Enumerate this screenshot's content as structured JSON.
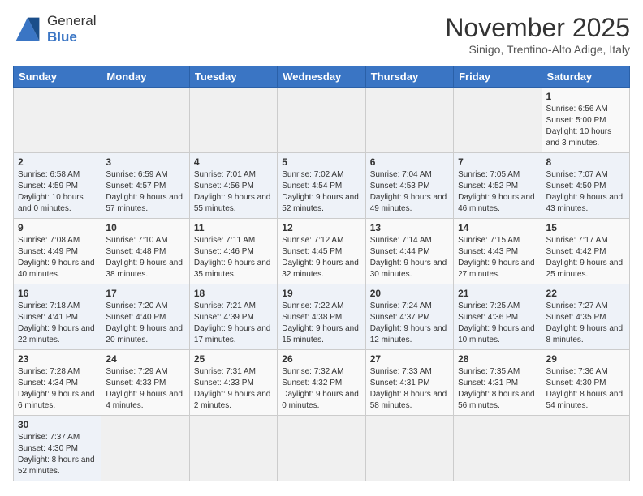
{
  "logo": {
    "line1": "General",
    "line2": "Blue"
  },
  "title": "November 2025",
  "subtitle": "Sinigo, Trentino-Alto Adige, Italy",
  "weekdays": [
    "Sunday",
    "Monday",
    "Tuesday",
    "Wednesday",
    "Thursday",
    "Friday",
    "Saturday"
  ],
  "weeks": [
    [
      {
        "day": "",
        "info": ""
      },
      {
        "day": "",
        "info": ""
      },
      {
        "day": "",
        "info": ""
      },
      {
        "day": "",
        "info": ""
      },
      {
        "day": "",
        "info": ""
      },
      {
        "day": "",
        "info": ""
      },
      {
        "day": "1",
        "info": "Sunrise: 6:56 AM\nSunset: 5:00 PM\nDaylight: 10 hours and 3 minutes."
      }
    ],
    [
      {
        "day": "2",
        "info": "Sunrise: 6:58 AM\nSunset: 4:59 PM\nDaylight: 10 hours and 0 minutes."
      },
      {
        "day": "3",
        "info": "Sunrise: 6:59 AM\nSunset: 4:57 PM\nDaylight: 9 hours and 57 minutes."
      },
      {
        "day": "4",
        "info": "Sunrise: 7:01 AM\nSunset: 4:56 PM\nDaylight: 9 hours and 55 minutes."
      },
      {
        "day": "5",
        "info": "Sunrise: 7:02 AM\nSunset: 4:54 PM\nDaylight: 9 hours and 52 minutes."
      },
      {
        "day": "6",
        "info": "Sunrise: 7:04 AM\nSunset: 4:53 PM\nDaylight: 9 hours and 49 minutes."
      },
      {
        "day": "7",
        "info": "Sunrise: 7:05 AM\nSunset: 4:52 PM\nDaylight: 9 hours and 46 minutes."
      },
      {
        "day": "8",
        "info": "Sunrise: 7:07 AM\nSunset: 4:50 PM\nDaylight: 9 hours and 43 minutes."
      }
    ],
    [
      {
        "day": "9",
        "info": "Sunrise: 7:08 AM\nSunset: 4:49 PM\nDaylight: 9 hours and 40 minutes."
      },
      {
        "day": "10",
        "info": "Sunrise: 7:10 AM\nSunset: 4:48 PM\nDaylight: 9 hours and 38 minutes."
      },
      {
        "day": "11",
        "info": "Sunrise: 7:11 AM\nSunset: 4:46 PM\nDaylight: 9 hours and 35 minutes."
      },
      {
        "day": "12",
        "info": "Sunrise: 7:12 AM\nSunset: 4:45 PM\nDaylight: 9 hours and 32 minutes."
      },
      {
        "day": "13",
        "info": "Sunrise: 7:14 AM\nSunset: 4:44 PM\nDaylight: 9 hours and 30 minutes."
      },
      {
        "day": "14",
        "info": "Sunrise: 7:15 AM\nSunset: 4:43 PM\nDaylight: 9 hours and 27 minutes."
      },
      {
        "day": "15",
        "info": "Sunrise: 7:17 AM\nSunset: 4:42 PM\nDaylight: 9 hours and 25 minutes."
      }
    ],
    [
      {
        "day": "16",
        "info": "Sunrise: 7:18 AM\nSunset: 4:41 PM\nDaylight: 9 hours and 22 minutes."
      },
      {
        "day": "17",
        "info": "Sunrise: 7:20 AM\nSunset: 4:40 PM\nDaylight: 9 hours and 20 minutes."
      },
      {
        "day": "18",
        "info": "Sunrise: 7:21 AM\nSunset: 4:39 PM\nDaylight: 9 hours and 17 minutes."
      },
      {
        "day": "19",
        "info": "Sunrise: 7:22 AM\nSunset: 4:38 PM\nDaylight: 9 hours and 15 minutes."
      },
      {
        "day": "20",
        "info": "Sunrise: 7:24 AM\nSunset: 4:37 PM\nDaylight: 9 hours and 12 minutes."
      },
      {
        "day": "21",
        "info": "Sunrise: 7:25 AM\nSunset: 4:36 PM\nDaylight: 9 hours and 10 minutes."
      },
      {
        "day": "22",
        "info": "Sunrise: 7:27 AM\nSunset: 4:35 PM\nDaylight: 9 hours and 8 minutes."
      }
    ],
    [
      {
        "day": "23",
        "info": "Sunrise: 7:28 AM\nSunset: 4:34 PM\nDaylight: 9 hours and 6 minutes."
      },
      {
        "day": "24",
        "info": "Sunrise: 7:29 AM\nSunset: 4:33 PM\nDaylight: 9 hours and 4 minutes."
      },
      {
        "day": "25",
        "info": "Sunrise: 7:31 AM\nSunset: 4:33 PM\nDaylight: 9 hours and 2 minutes."
      },
      {
        "day": "26",
        "info": "Sunrise: 7:32 AM\nSunset: 4:32 PM\nDaylight: 9 hours and 0 minutes."
      },
      {
        "day": "27",
        "info": "Sunrise: 7:33 AM\nSunset: 4:31 PM\nDaylight: 8 hours and 58 minutes."
      },
      {
        "day": "28",
        "info": "Sunrise: 7:35 AM\nSunset: 4:31 PM\nDaylight: 8 hours and 56 minutes."
      },
      {
        "day": "29",
        "info": "Sunrise: 7:36 AM\nSunset: 4:30 PM\nDaylight: 8 hours and 54 minutes."
      }
    ],
    [
      {
        "day": "30",
        "info": "Sunrise: 7:37 AM\nSunset: 4:30 PM\nDaylight: 8 hours and 52 minutes."
      },
      {
        "day": "",
        "info": ""
      },
      {
        "day": "",
        "info": ""
      },
      {
        "day": "",
        "info": ""
      },
      {
        "day": "",
        "info": ""
      },
      {
        "day": "",
        "info": ""
      },
      {
        "day": "",
        "info": ""
      }
    ]
  ]
}
